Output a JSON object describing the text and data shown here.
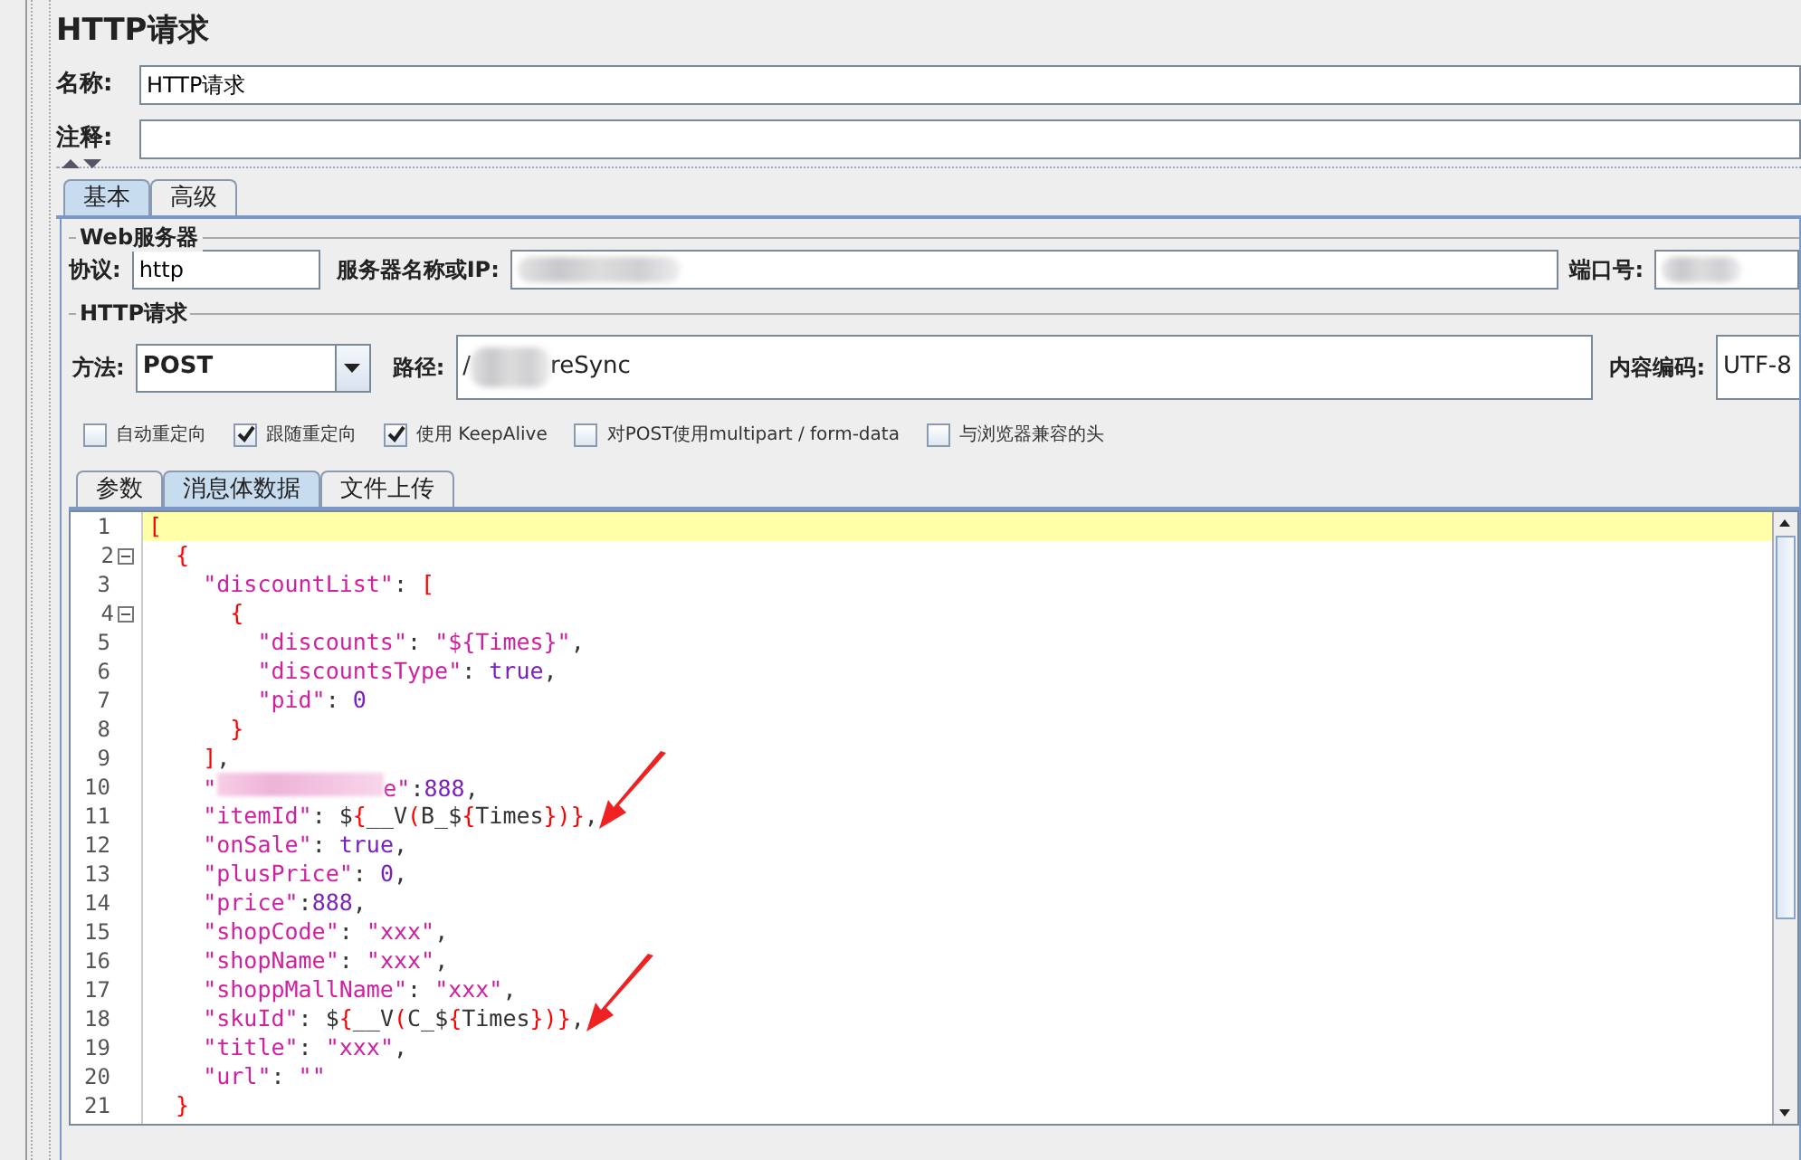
{
  "title": "HTTP请求",
  "name_field": {
    "label": "名称:",
    "value": "HTTP请求"
  },
  "comment_field": {
    "label": "注释:"
  },
  "tabs": [
    {
      "label": "基本",
      "selected": true
    },
    {
      "label": "高级",
      "selected": false
    }
  ],
  "web_server": {
    "legend": "Web服务器",
    "protocol_label": "协议:",
    "protocol": "http",
    "server_label": "服务器名称或IP:",
    "server_redacted": true,
    "port_label": "端口号:",
    "port_redacted": true
  },
  "http_request": {
    "legend": "HTTP请求",
    "method_label": "方法:",
    "method": "POST",
    "path_label": "路径:",
    "path_start": "/",
    "path_end": "reSync",
    "path_redacted": true,
    "encoding_label": "内容编码:",
    "encoding": "UTF-8"
  },
  "options": [
    {
      "label": "自动重定向",
      "checked": false
    },
    {
      "label": "跟随重定向",
      "checked": true
    },
    {
      "label": "使用 KeepAlive",
      "checked": true
    },
    {
      "label": "对POST使用multipart / form-data",
      "checked": false
    },
    {
      "label": "与浏览器兼容的头",
      "checked": false
    }
  ],
  "body_tabs": [
    {
      "label": "参数",
      "selected": false
    },
    {
      "label": "消息体数据",
      "selected": true
    },
    {
      "label": "文件上传",
      "selected": false
    }
  ],
  "code_lines": [
    {
      "number": "1",
      "current": true,
      "tokens": [
        {
          "kind": "bracket",
          "text": "["
        }
      ]
    },
    {
      "number": "2",
      "fold": true,
      "tokens": [
        {
          "kind": "bracket",
          "text": "  {"
        }
      ]
    },
    {
      "number": "3",
      "tokens": [
        {
          "kind": "string",
          "text": "    \"discountList\""
        },
        {
          "kind": "plain",
          "text": ": "
        },
        {
          "kind": "bracket",
          "text": "["
        }
      ]
    },
    {
      "number": "4",
      "fold": true,
      "tokens": [
        {
          "kind": "bracket",
          "text": "      {"
        }
      ]
    },
    {
      "number": "5",
      "tokens": [
        {
          "kind": "string",
          "text": "        \"discounts\""
        },
        {
          "kind": "plain",
          "text": ": "
        },
        {
          "kind": "string",
          "text": "\"${Times}\""
        },
        {
          "kind": "plain",
          "text": ","
        }
      ]
    },
    {
      "number": "6",
      "tokens": [
        {
          "kind": "string",
          "text": "        \"discountsType\""
        },
        {
          "kind": "plain",
          "text": ": "
        },
        {
          "kind": "literal",
          "text": "true"
        },
        {
          "kind": "plain",
          "text": ","
        }
      ]
    },
    {
      "number": "7",
      "tokens": [
        {
          "kind": "string",
          "text": "        \"pid\""
        },
        {
          "kind": "plain",
          "text": ": "
        },
        {
          "kind": "literal",
          "text": "0"
        }
      ]
    },
    {
      "number": "8",
      "tokens": [
        {
          "kind": "bracket",
          "text": "      }"
        }
      ]
    },
    {
      "number": "9",
      "tokens": [
        {
          "kind": "bracket",
          "text": "    ]"
        },
        {
          "kind": "plain",
          "text": ","
        }
      ]
    },
    {
      "number": "10",
      "tokens": [
        {
          "kind": "string",
          "text": "    \""
        },
        {
          "kind": "redacted"
        },
        {
          "kind": "string",
          "text": "e\""
        },
        {
          "kind": "plain",
          "text": ":"
        },
        {
          "kind": "literal",
          "text": "888"
        },
        {
          "kind": "plain",
          "text": ","
        }
      ]
    },
    {
      "number": "11",
      "arrow": true,
      "tokens": [
        {
          "kind": "string",
          "text": "    \"itemId\""
        },
        {
          "kind": "plain",
          "text": ": $"
        },
        {
          "kind": "bracket",
          "text": "{"
        },
        {
          "kind": "plain",
          "text": "__V"
        },
        {
          "kind": "bracket",
          "text": "("
        },
        {
          "kind": "plain",
          "text": "B_$"
        },
        {
          "kind": "bracket",
          "text": "{"
        },
        {
          "kind": "plain",
          "text": "Times"
        },
        {
          "kind": "bracket",
          "text": "})}"
        },
        {
          "kind": "plain",
          "text": ","
        }
      ]
    },
    {
      "number": "12",
      "tokens": [
        {
          "kind": "string",
          "text": "    \"onSale\""
        },
        {
          "kind": "plain",
          "text": ": "
        },
        {
          "kind": "literal",
          "text": "true"
        },
        {
          "kind": "plain",
          "text": ","
        }
      ]
    },
    {
      "number": "13",
      "tokens": [
        {
          "kind": "string",
          "text": "    \"plusPrice\""
        },
        {
          "kind": "plain",
          "text": ": "
        },
        {
          "kind": "literal",
          "text": "0"
        },
        {
          "kind": "plain",
          "text": ","
        }
      ]
    },
    {
      "number": "14",
      "tokens": [
        {
          "kind": "string",
          "text": "    \"price\""
        },
        {
          "kind": "plain",
          "text": ":"
        },
        {
          "kind": "literal",
          "text": "888"
        },
        {
          "kind": "plain",
          "text": ","
        }
      ]
    },
    {
      "number": "15",
      "tokens": [
        {
          "kind": "string",
          "text": "    \"shopCode\""
        },
        {
          "kind": "plain",
          "text": ": "
        },
        {
          "kind": "string",
          "text": "\"xxx\""
        },
        {
          "kind": "plain",
          "text": ","
        }
      ]
    },
    {
      "number": "16",
      "tokens": [
        {
          "kind": "string",
          "text": "    \"shopName\""
        },
        {
          "kind": "plain",
          "text": ": "
        },
        {
          "kind": "string",
          "text": "\"xxx\""
        },
        {
          "kind": "plain",
          "text": ","
        }
      ]
    },
    {
      "number": "17",
      "tokens": [
        {
          "kind": "string",
          "text": "    \"shoppMallName\""
        },
        {
          "kind": "plain",
          "text": ": "
        },
        {
          "kind": "string",
          "text": "\"xxx\""
        },
        {
          "kind": "plain",
          "text": ","
        }
      ]
    },
    {
      "number": "18",
      "arrow": true,
      "tokens": [
        {
          "kind": "string",
          "text": "    \"skuId\""
        },
        {
          "kind": "plain",
          "text": ": $"
        },
        {
          "kind": "bracket",
          "text": "{"
        },
        {
          "kind": "plain",
          "text": "__V"
        },
        {
          "kind": "bracket",
          "text": "("
        },
        {
          "kind": "plain",
          "text": "C_$"
        },
        {
          "kind": "bracket",
          "text": "{"
        },
        {
          "kind": "plain",
          "text": "Times"
        },
        {
          "kind": "bracket",
          "text": "})}"
        },
        {
          "kind": "plain",
          "text": ","
        }
      ]
    },
    {
      "number": "19",
      "tokens": [
        {
          "kind": "string",
          "text": "    \"title\""
        },
        {
          "kind": "plain",
          "text": ": "
        },
        {
          "kind": "string",
          "text": "\"xxx\""
        },
        {
          "kind": "plain",
          "text": ","
        }
      ]
    },
    {
      "number": "20",
      "tokens": [
        {
          "kind": "string",
          "text": "    \"url\""
        },
        {
          "kind": "plain",
          "text": ": "
        },
        {
          "kind": "string",
          "text": "\"\""
        }
      ]
    },
    {
      "number": "21",
      "tokens": [
        {
          "kind": "bracket",
          "text": "  }"
        }
      ]
    }
  ]
}
